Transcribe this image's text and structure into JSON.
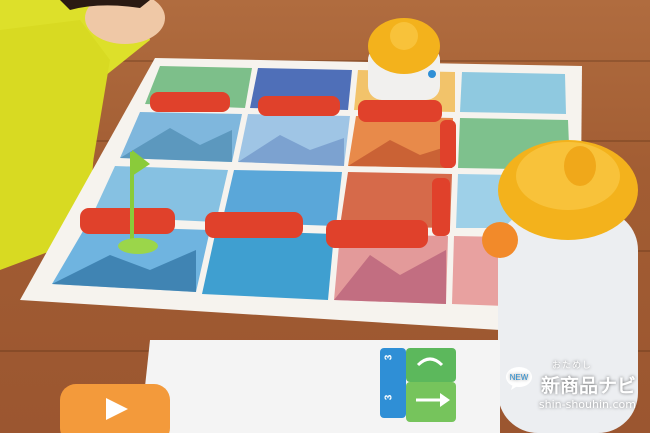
{
  "scene": {
    "description_free": true,
    "colors": {
      "table_wood": "#a8643a",
      "board_white": "#f6f3ee",
      "block_red": "#e0412b",
      "robot_yellow": "#f3b21c",
      "card_green": "#5cb85c",
      "card_blue": "#2f8fd6"
    }
  },
  "watermark": {
    "small_text": "おためし",
    "main_text": "新商品ナビ",
    "url_text": "shin-shouhin.com"
  },
  "cards": {
    "top_digit": "3",
    "bottom_digit": "3"
  }
}
